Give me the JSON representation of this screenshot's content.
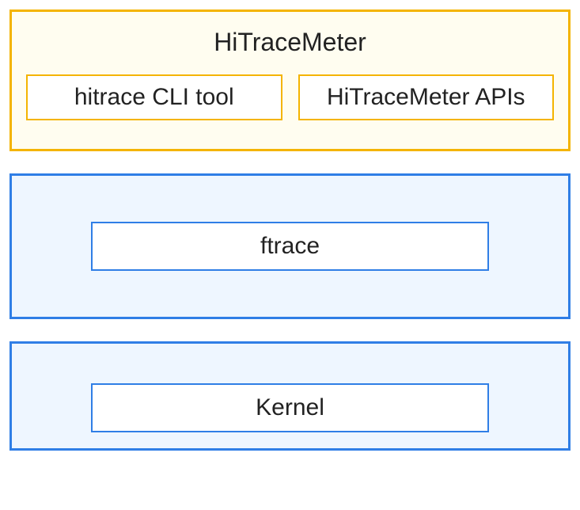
{
  "top": {
    "title": "HiTraceMeter",
    "left_box": "hitrace CLI tool",
    "right_box": "HiTraceMeter APIs"
  },
  "middle": {
    "box": "ftrace"
  },
  "bottom": {
    "box": "Kernel"
  }
}
